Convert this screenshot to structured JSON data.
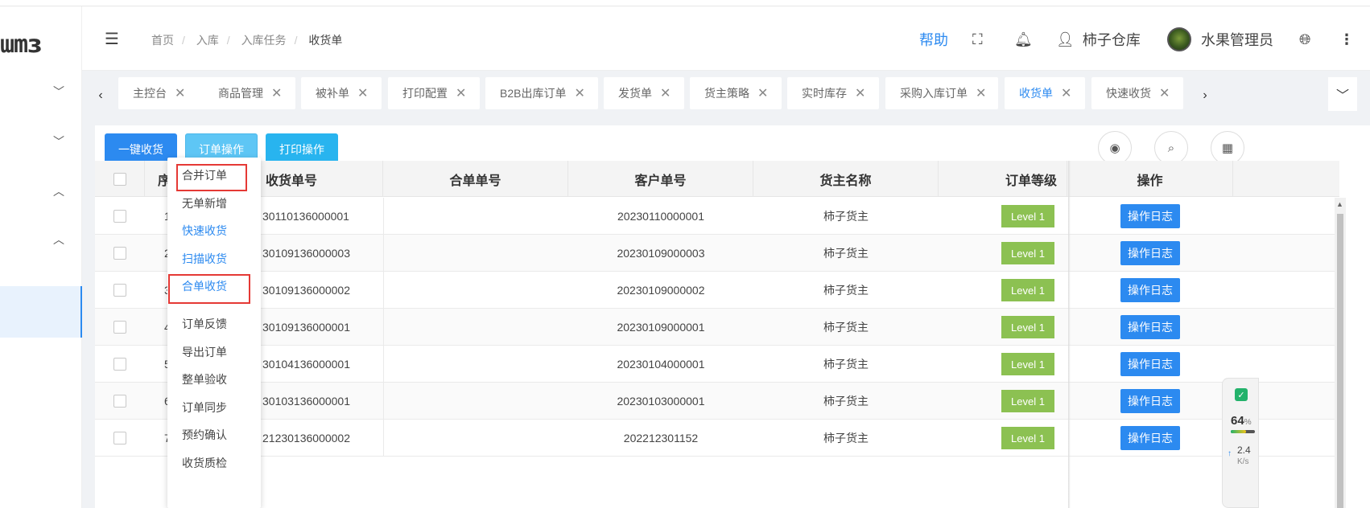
{
  "brand": {
    "logo_text": "ɯmɜ"
  },
  "header": {
    "breadcrumb": [
      "首页",
      "入库",
      "入库任务",
      "收货单"
    ],
    "breadcrumb_sep": "/",
    "help": "帮助",
    "warehouse": "柿子仓库",
    "user": "水果管理员"
  },
  "tabs": [
    {
      "label": "主控台"
    },
    {
      "label": "商品管理"
    },
    {
      "label": "被补单"
    },
    {
      "label": "打印配置"
    },
    {
      "label": "B2B出库订单"
    },
    {
      "label": "发货单"
    },
    {
      "label": "货主策略"
    },
    {
      "label": "实时库存"
    },
    {
      "label": "采购入库订单"
    },
    {
      "label": "收货单",
      "active": true
    },
    {
      "label": "快速收货"
    }
  ],
  "tab_close": "✕",
  "toolbar": {
    "one_click": "一键收货",
    "order_ops": "订单操作",
    "print_ops": "打印操作"
  },
  "dropdown": [
    {
      "label": "合并订单",
      "highlight": true
    },
    {
      "label": "无单新增"
    },
    {
      "label": "快速收货",
      "color": "blue"
    },
    {
      "label": "扫描收货",
      "color": "blue"
    },
    {
      "label": "合单收货",
      "color": "blue",
      "highlight": true
    },
    {
      "label": "订单反馈"
    },
    {
      "label": "导出订单"
    },
    {
      "label": "整单验收"
    },
    {
      "label": "订单同步"
    },
    {
      "label": "预约确认"
    },
    {
      "label": "收货质检"
    }
  ],
  "table": {
    "columns": [
      "序",
      "收货单号",
      "合单单号",
      "客户单号",
      "货主名称",
      "订单等级",
      "操作"
    ],
    "rows": [
      {
        "idx": "1",
        "receipt_no": "30110136000001",
        "merge_no": "",
        "customer_no": "20230110000001",
        "owner": "柿子货主",
        "level": "Level 1",
        "action": "操作日志"
      },
      {
        "idx": "2",
        "receipt_no": "30109136000003",
        "merge_no": "",
        "customer_no": "20230109000003",
        "owner": "柿子货主",
        "level": "Level 1",
        "action": "操作日志"
      },
      {
        "idx": "3",
        "receipt_no": "30109136000002",
        "merge_no": "",
        "customer_no": "20230109000002",
        "owner": "柿子货主",
        "level": "Level 1",
        "action": "操作日志"
      },
      {
        "idx": "4",
        "receipt_no": "30109136000001",
        "merge_no": "",
        "customer_no": "20230109000001",
        "owner": "柿子货主",
        "level": "Level 1",
        "action": "操作日志"
      },
      {
        "idx": "5",
        "receipt_no": "30104136000001",
        "merge_no": "",
        "customer_no": "20230104000001",
        "owner": "柿子货主",
        "level": "Level 1",
        "action": "操作日志"
      },
      {
        "idx": "6",
        "receipt_no": "30103136000001",
        "merge_no": "",
        "customer_no": "20230103000001",
        "owner": "柿子货主",
        "level": "Level 1",
        "action": "操作日志"
      },
      {
        "idx": "7",
        "receipt_no": "21230136000002",
        "merge_no": "",
        "customer_no": "202212301152",
        "owner": "柿子货主",
        "level": "Level 1",
        "action": "操作日志"
      }
    ]
  },
  "net_widget": {
    "percent": "64",
    "percent_unit": "%",
    "speed": "2.4",
    "speed_unit": "K/s",
    "level": 0.64
  },
  "colors": {
    "accent": "#2c8af0",
    "level_badge": "#8cc152",
    "highlight_box": "#e53935"
  }
}
